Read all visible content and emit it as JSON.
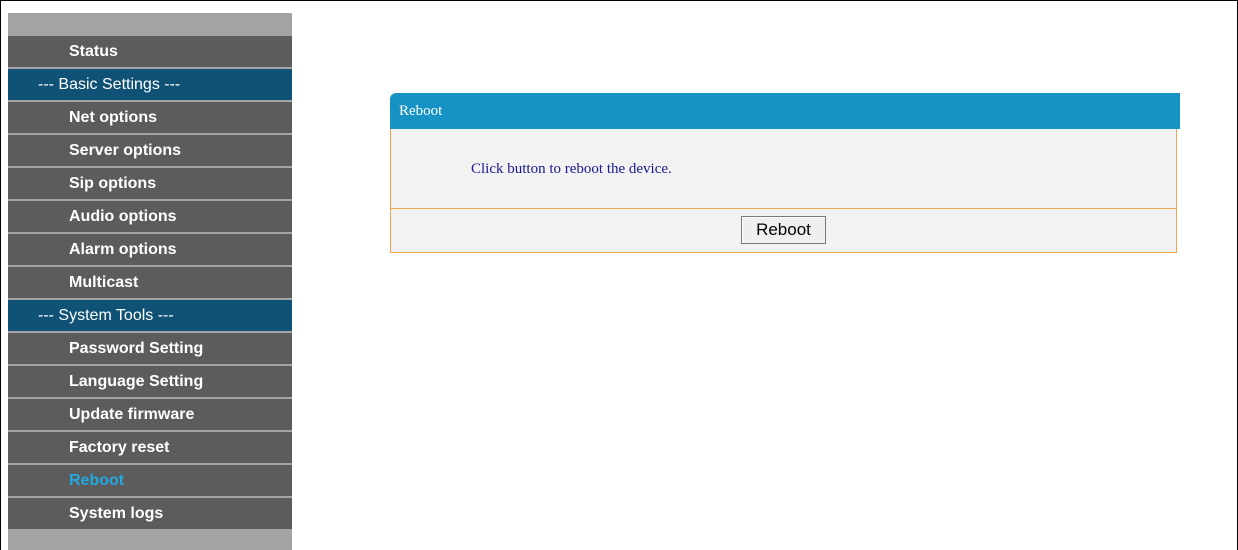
{
  "sidebar": {
    "items": [
      {
        "type": "item",
        "label": "Status"
      },
      {
        "type": "group",
        "label": "--- Basic Settings ---"
      },
      {
        "type": "item",
        "label": "Net options"
      },
      {
        "type": "item",
        "label": "Server options"
      },
      {
        "type": "item",
        "label": "Sip options"
      },
      {
        "type": "item",
        "label": "Audio options"
      },
      {
        "type": "item",
        "label": "Alarm options"
      },
      {
        "type": "item",
        "label": "Multicast"
      },
      {
        "type": "group",
        "label": "--- System Tools ---"
      },
      {
        "type": "item",
        "label": "Password Setting"
      },
      {
        "type": "item",
        "label": "Language Setting"
      },
      {
        "type": "item",
        "label": "Update firmware"
      },
      {
        "type": "item",
        "label": "Factory reset"
      },
      {
        "type": "item",
        "label": "Reboot",
        "active": true
      },
      {
        "type": "item",
        "label": "System logs"
      }
    ]
  },
  "panel": {
    "title": "Reboot",
    "message": "Click button to reboot the device.",
    "button_label": "Reboot"
  },
  "colors": {
    "menu_bg": "#5c5c5c",
    "group_bg": "#0f5275",
    "active_text": "#22a8e0",
    "panel_header": "#1792c5",
    "panel_border": "#f4a54a"
  }
}
